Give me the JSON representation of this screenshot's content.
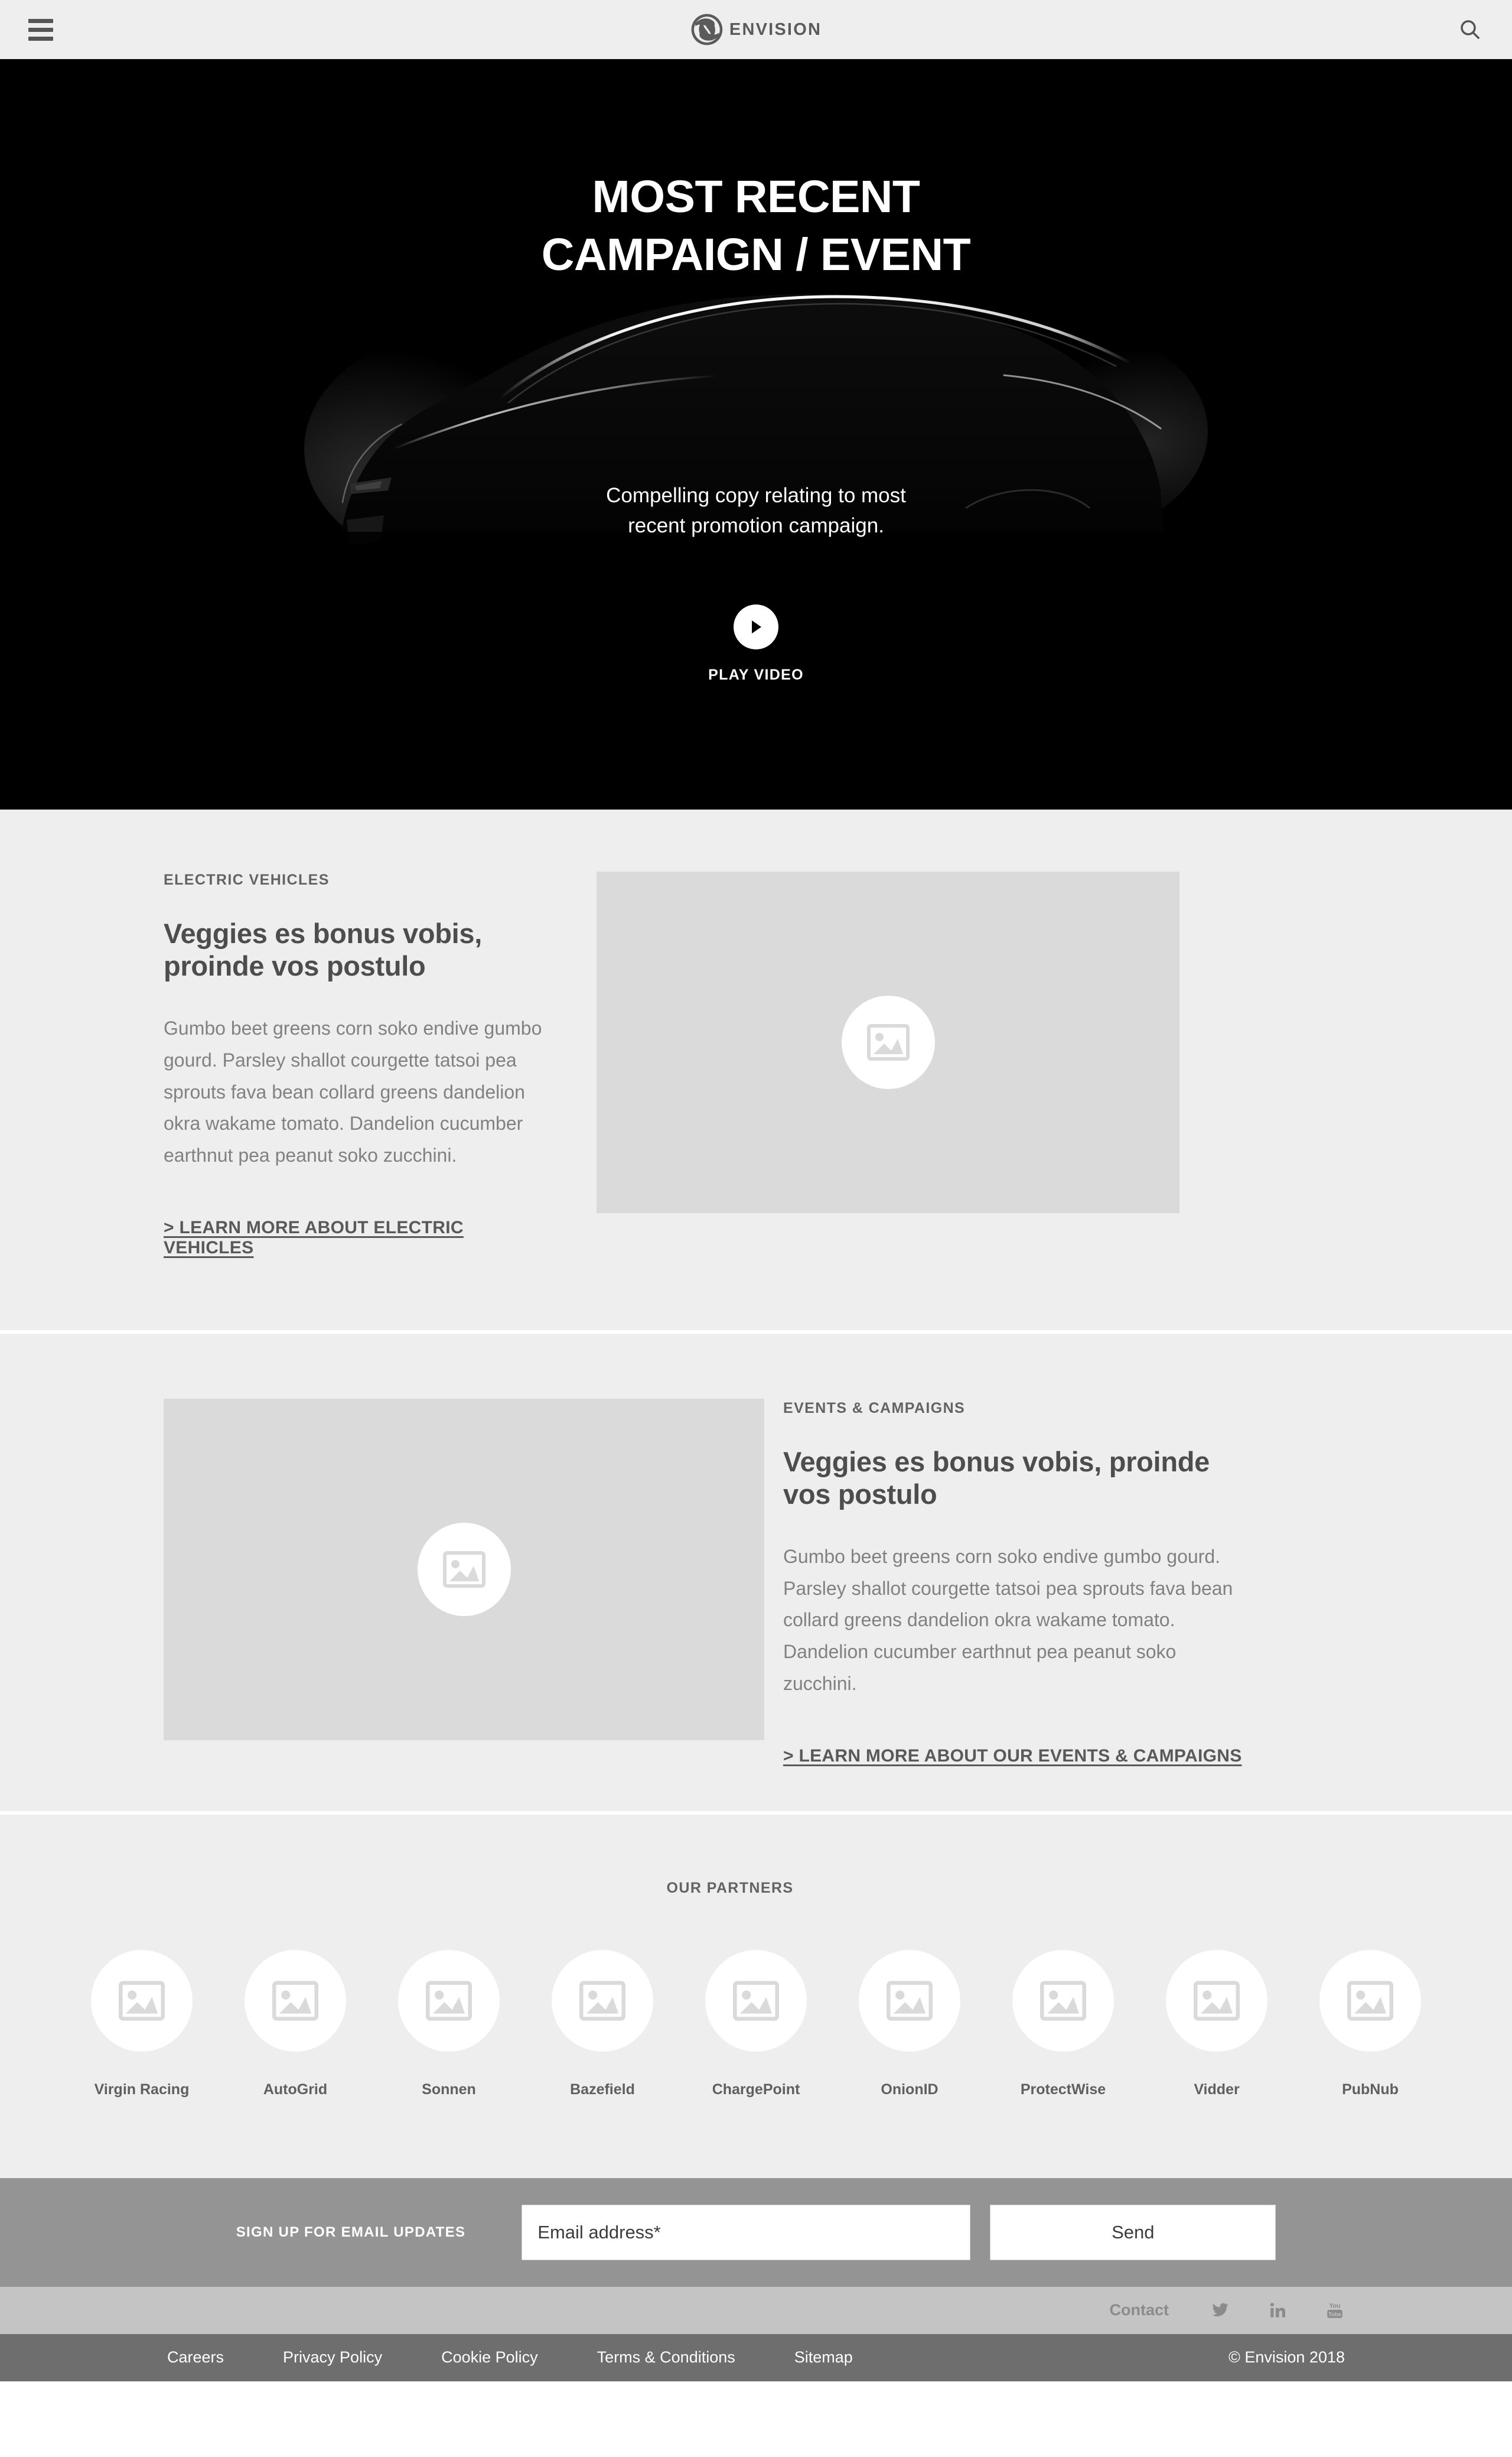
{
  "header": {
    "menu_icon": "hamburger-menu-icon",
    "logo_text": "ENVISION",
    "search_icon": "search-icon"
  },
  "hero": {
    "title_line1": "MOST RECENT",
    "title_line2": "CAMPAIGN / EVENT",
    "copy_line1": "Compelling copy relating to most",
    "copy_line2": "recent promotion campaign.",
    "play_label": "PLAY VIDEO",
    "play_icon": "play-triangle-icon",
    "background": "#000000"
  },
  "sections": [
    {
      "eyebrow": "ELECTRIC VEHICLES",
      "headline": "Veggies es bonus vobis, proinde vos postulo",
      "body": "Gumbo beet greens corn soko endive gumbo gourd. Parsley shallot courgette tatsoi pea sprouts fava bean collard greens dandelion okra wakame tomato. Dandelion cucumber earthnut pea peanut soko zucchini.",
      "link": "> LEARN MORE ABOUT ELECTRIC VEHICLES",
      "image_icon": "image-placeholder-icon"
    },
    {
      "eyebrow": "EVENTS & CAMPAIGNS",
      "headline": "Veggies es bonus vobis, proinde vos postulo",
      "body": "Gumbo beet greens corn soko endive gumbo gourd. Parsley shallot courgette tatsoi pea sprouts fava bean collard greens dandelion okra wakame tomato. Dandelion cucumber earthnut pea peanut soko zucchini.",
      "link": "> LEARN MORE ABOUT OUR EVENTS & CAMPAIGNS",
      "image_icon": "image-placeholder-icon"
    }
  ],
  "partners": {
    "title": "OUR PARTNERS",
    "items": [
      {
        "name": "Virgin Racing"
      },
      {
        "name": "AutoGrid"
      },
      {
        "name": "Sonnen"
      },
      {
        "name": "Bazefield"
      },
      {
        "name": "ChargePoint"
      },
      {
        "name": "OnionID"
      },
      {
        "name": "ProtectWise"
      },
      {
        "name": "Vidder"
      },
      {
        "name": "PubNub"
      }
    ]
  },
  "signup": {
    "label": "SIGN UP FOR EMAIL UPDATES",
    "email_value": "",
    "email_placeholder": "Email address*",
    "send_label": "Send"
  },
  "social": {
    "contact_label": "Contact",
    "icons": [
      "twitter-icon",
      "linkedin-icon",
      "youtube-icon"
    ]
  },
  "footer": {
    "links": [
      "Careers",
      "Privacy Policy",
      "Cookie Policy",
      "Terms & Conditions",
      "Sitemap"
    ],
    "copyright": "© Envision 2018"
  },
  "colors": {
    "page_bg": "#eeeeee",
    "hero_bg": "#000000",
    "placeholder": "#dadada",
    "signup_bg": "#949494",
    "social_bg": "#c4c4c4",
    "footer_bg": "#6e6e6e",
    "text_dark": "#4d4d4d",
    "text_muted": "#818181"
  }
}
